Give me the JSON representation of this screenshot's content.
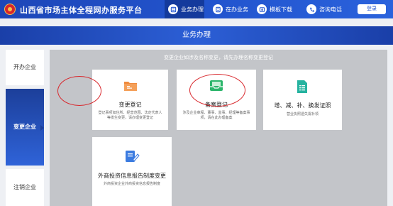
{
  "header": {
    "site_title": "山西省市场主体全程网办服务平台",
    "nav": [
      {
        "label": "业务办理",
        "icon": "business-icon"
      },
      {
        "label": "在办业务",
        "icon": "list-icon"
      },
      {
        "label": "模板下载",
        "icon": "download-icon"
      },
      {
        "label": "咨询电话",
        "icon": "phone-icon"
      }
    ],
    "login_label": "登录"
  },
  "banner": {
    "title": "业务办理"
  },
  "sidebar": {
    "items": [
      {
        "label": "开办企业",
        "active": false
      },
      {
        "label": "变更企业",
        "active": true
      },
      {
        "label": "注销企业",
        "active": false
      }
    ]
  },
  "main": {
    "notice": "变更企业如涉及名称变更，请先办理名称变更登记",
    "cards": [
      {
        "title": "变更登记",
        "desc": "登记事项如住所、经营范围、法定代表人等发生变更，请办理变更登记",
        "icon": "folder-icon",
        "accent": "#f08a3c"
      },
      {
        "title": "备案登记",
        "desc": "涉及企业章程、董事、监事、经理等备案事项，请在此办理备案",
        "icon": "inbox-icon",
        "accent": "#2bb56b"
      },
      {
        "title": "增、减、补、换发证照",
        "desc": "营业执照遗失需补领",
        "icon": "document-icon",
        "accent": "#26b3a0"
      },
      {
        "title": "外商投资信息报告制度变更",
        "desc": "外商投资企业外商投资信息报告制度",
        "icon": "edit-icon",
        "accent": "#3b7be0"
      }
    ]
  },
  "colors": {
    "primary": "#2356d0",
    "highlight": "#d8262b"
  }
}
